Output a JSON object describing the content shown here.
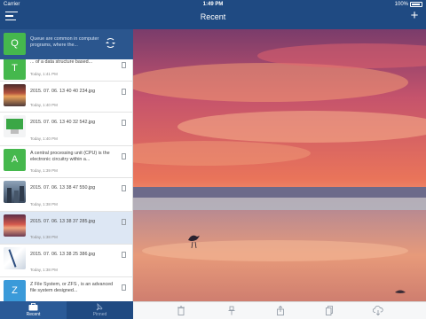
{
  "status_bar": {
    "carrier": "Carrier",
    "time": "1:49 PM",
    "battery": "100%"
  },
  "nav": {
    "title": "Recent"
  },
  "swipe_row": {
    "letter": "Q",
    "text": "Queue are common in computer programs, where the..."
  },
  "items": [
    {
      "kind": "letter",
      "letter": "T",
      "color": "#45b84d",
      "text": "... of a data structure based...",
      "date": "Today, 1:41 PM"
    },
    {
      "kind": "image",
      "thumb": "sunset1",
      "text": "2015. 07. 06. 13 40 40 234.jpg",
      "date": "Today, 1:40 PM"
    },
    {
      "kind": "image",
      "thumb": "screen",
      "text": "2015. 07. 06. 13 40 32 542.jpg",
      "date": "Today, 1:40 PM"
    },
    {
      "kind": "letter",
      "letter": "A",
      "color": "#45b84d",
      "text": "A central processing unit (CPU) is the electronic circuitry within a...",
      "date": "Today, 1:39 PM"
    },
    {
      "kind": "image",
      "thumb": "city",
      "text": "2015. 07. 06. 13 38 47 550.jpg",
      "date": "Today, 1:38 PM"
    },
    {
      "kind": "image",
      "thumb": "sunset2",
      "text": "2015. 07. 06. 13 38 37 285.jpg",
      "date": "Today, 1:38 PM",
      "selected": true
    },
    {
      "kind": "image",
      "thumb": "book",
      "text": "2015. 07. 06. 13 38 25 386.jpg",
      "date": "Today, 1:38 PM"
    },
    {
      "kind": "letter",
      "letter": "Z",
      "color": "#3a9ad9",
      "text": "Z File System, or ZFS , is an advanced file system designed...",
      "date": ""
    }
  ],
  "tabs": [
    {
      "label": "Recent",
      "active": true,
      "icon": "briefcase-icon"
    },
    {
      "label": "Pinned",
      "active": false,
      "icon": "pin-icon"
    }
  ],
  "toolbar_icons": [
    "trash-icon",
    "pin-icon",
    "share-icon",
    "copy-icon",
    "cloud-download-icon"
  ]
}
